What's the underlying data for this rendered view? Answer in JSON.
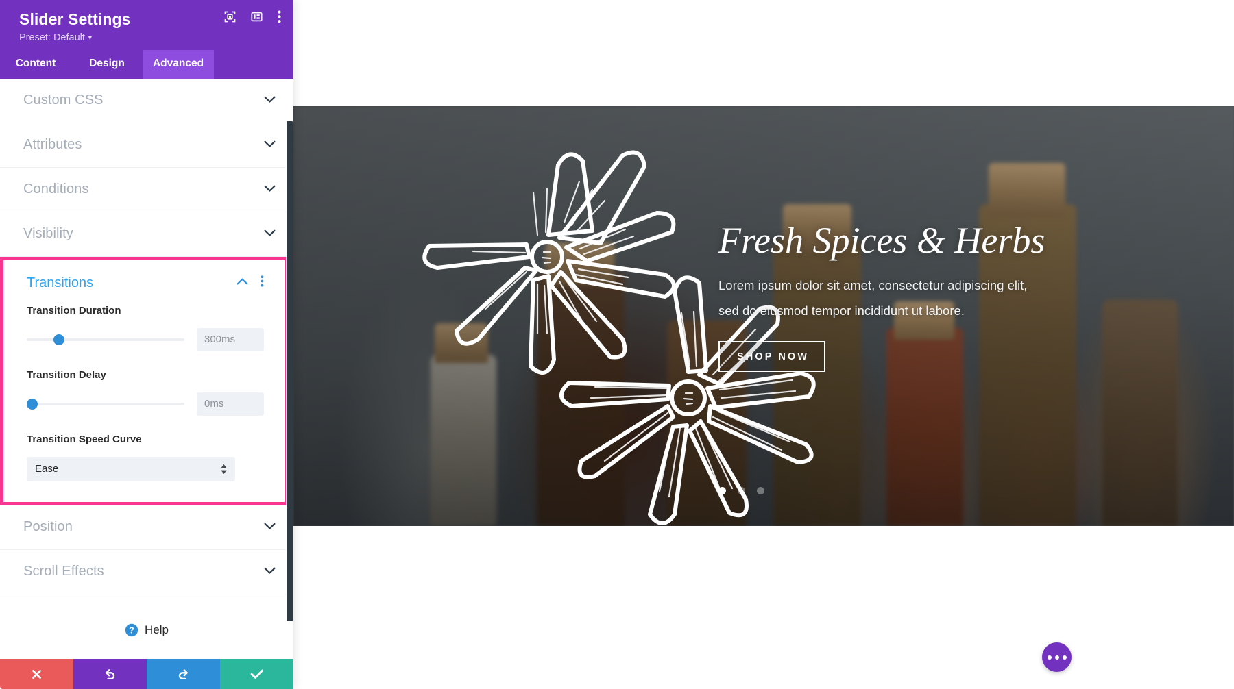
{
  "sidebar": {
    "title": "Slider Settings",
    "preset": "Preset: Default",
    "header_icons": [
      {
        "name": "focus-target-icon"
      },
      {
        "name": "panel-layout-icon"
      },
      {
        "name": "more-options-icon"
      }
    ],
    "tabs": [
      {
        "label": "Content",
        "active": false
      },
      {
        "label": "Design",
        "active": false
      },
      {
        "label": "Advanced",
        "active": true
      }
    ],
    "sections_above": [
      {
        "label": "Custom CSS"
      },
      {
        "label": "Attributes"
      },
      {
        "label": "Conditions"
      },
      {
        "label": "Visibility"
      }
    ],
    "transitions": {
      "title": "Transitions",
      "expanded": true,
      "highlight_color": "#f8368f",
      "accent_color": "#2ea3f2",
      "fields": {
        "duration_label": "Transition Duration",
        "duration_value": "300ms",
        "duration_percent": 17,
        "delay_label": "Transition Delay",
        "delay_value": "0ms",
        "delay_percent": 0,
        "curve_label": "Transition Speed Curve",
        "curve_value": "Ease"
      }
    },
    "sections_below": [
      {
        "label": "Position"
      },
      {
        "label": "Scroll Effects"
      }
    ],
    "help": {
      "label": "Help"
    },
    "actions": [
      {
        "name": "close",
        "icon": "close-icon",
        "color": "#eb5a5a"
      },
      {
        "name": "undo",
        "icon": "undo-icon",
        "color": "#7331c0"
      },
      {
        "name": "redo",
        "icon": "redo-icon",
        "color": "#2e8fd8"
      },
      {
        "name": "save",
        "icon": "check-icon",
        "color": "#2bb79c"
      }
    ]
  },
  "canvas": {
    "slide": {
      "title": "Fresh Spices & Herbs",
      "subtitle_line1": "Lorem ipsum dolor sit amet, consectetur adipiscing elit,",
      "subtitle_line2": "sed do eiusmod tempor incididunt ut labore.",
      "button_label": "SHOP NOW",
      "dots": 3,
      "active_dot": 0
    },
    "fab": {
      "name": "page-settings-fab"
    }
  }
}
